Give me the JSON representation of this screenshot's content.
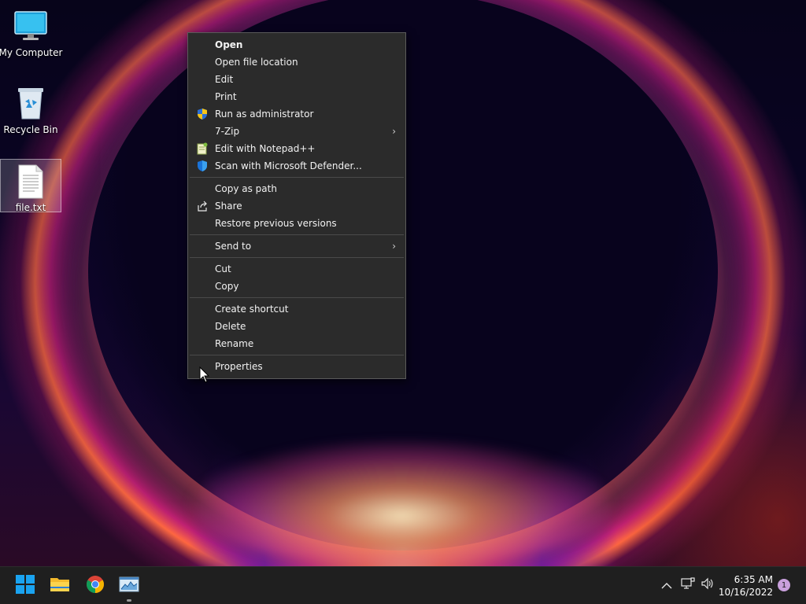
{
  "desktop": {
    "icons": [
      {
        "label": "My Computer",
        "icon": "monitor-icon"
      },
      {
        "label": "Recycle Bin",
        "icon": "recycle-bin-icon"
      },
      {
        "label": "file.txt",
        "icon": "text-file-icon",
        "selected": true
      }
    ]
  },
  "context_menu": {
    "items": [
      {
        "label": "Open",
        "bold": true
      },
      {
        "label": "Open file location"
      },
      {
        "label": "Edit"
      },
      {
        "label": "Print"
      },
      {
        "label": "Run as administrator",
        "icon": "uac-shield-icon"
      },
      {
        "label": "7-Zip",
        "submenu": true
      },
      {
        "label": "Edit with Notepad++",
        "icon": "notepad-plus-plus-icon"
      },
      {
        "label": "Scan with Microsoft Defender...",
        "icon": "defender-shield-icon"
      },
      {
        "label": "Copy as path"
      },
      {
        "label": "Share",
        "icon": "share-icon"
      },
      {
        "label": "Restore previous versions"
      },
      {
        "label": "Send to",
        "submenu": true
      },
      {
        "label": "Cut"
      },
      {
        "label": "Copy"
      },
      {
        "label": "Create shortcut"
      },
      {
        "label": "Delete"
      },
      {
        "label": "Rename"
      },
      {
        "label": "Properties"
      }
    ],
    "submenu_arrow": "›"
  },
  "taskbar": {
    "apps": [
      {
        "name": "Start",
        "icon": "windows-start-icon"
      },
      {
        "name": "File Explorer",
        "icon": "file-explorer-icon"
      },
      {
        "name": "Google Chrome",
        "icon": "chrome-icon"
      },
      {
        "name": "Task Manager",
        "icon": "task-manager-icon"
      }
    ],
    "tray": {
      "chevron": "^",
      "icons": [
        "show-hidden-icons-chevron",
        "network-icon",
        "volume-icon"
      ]
    },
    "clock": {
      "time": "6:35 AM",
      "date": "10/16/2022"
    },
    "notification_count": "1"
  },
  "colors": {
    "menu_bg": "#2b2b2b",
    "taskbar_bg": "#1f1f1f",
    "accent_blue": "#0078d4"
  }
}
